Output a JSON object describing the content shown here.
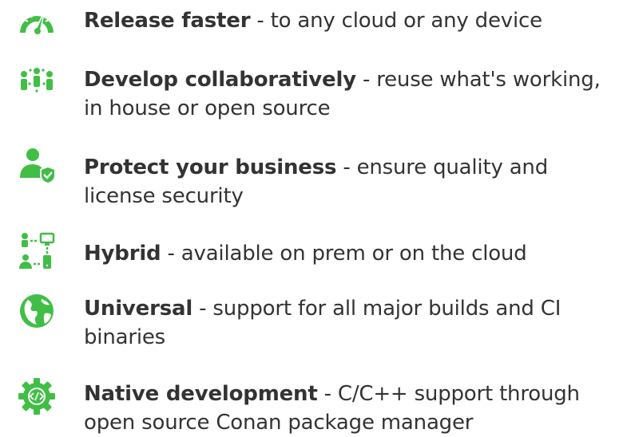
{
  "colors": {
    "icon_green": "#40be46",
    "text": "#333333",
    "background": "#ffffff"
  },
  "features": [
    {
      "icon": "speedometer-icon",
      "title": "Release faster",
      "description": " - to any cloud or any device"
    },
    {
      "icon": "team-collaboration-icon",
      "title": "Develop collaboratively",
      "description": " - reuse what's working, in house or open source"
    },
    {
      "icon": "user-shield-icon",
      "title": "Protect your business",
      "description": " - ensure quality and license security"
    },
    {
      "icon": "hybrid-network-icon",
      "title": "Hybrid",
      "description": " - available on prem or on the cloud"
    },
    {
      "icon": "globe-icon",
      "title": "Universal",
      "description": " - support for all major builds and CI binaries"
    },
    {
      "icon": "code-gear-icon",
      "title": "Native development",
      "description": " - C/C++ support through open source Conan package manager"
    }
  ]
}
